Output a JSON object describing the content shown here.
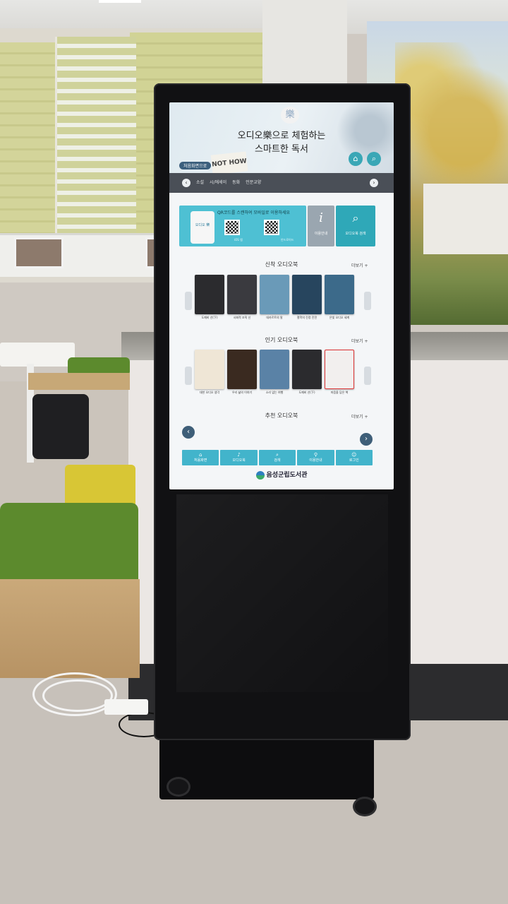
{
  "screen": {
    "hero": {
      "logo_glyph": "樂",
      "title_line1": "오디오樂으로 체험하는",
      "title_line2": "스마트한 독서",
      "back_pill": "처음화면으로",
      "book_text": "NOT HOW"
    },
    "nav": {
      "items": [
        "소설",
        "시/에세이",
        "동화",
        "인문교양"
      ],
      "prev_icon": "‹",
      "next_icon": "›"
    },
    "qr": {
      "instruction": "QR코드를 스캔하여 모바일로 이용하세요",
      "phone_label": "오디오 樂",
      "cap_a": "iOS 앱",
      "cap_b": "안드로이드"
    },
    "info_button": {
      "icon": "i",
      "label": "이용안내"
    },
    "search_button": {
      "icon": "⌕",
      "label": "오디오북 검색"
    },
    "sections": {
      "new": {
        "title": "신착 오디오북",
        "more": "더보기 +"
      },
      "popular": {
        "title": "인기 오디오북",
        "more": "더보기 +"
      },
      "recommended": {
        "title": "추천 오디오북",
        "more": "더보기 +"
      }
    },
    "new_books": [
      {
        "title": "도깨비 선(下)",
        "color": "#2b2b2e"
      },
      {
        "title": "사회적 조직 신",
        "color": "#3a3a3f"
      },
      {
        "title": "데카르트의 말",
        "color": "#6a9ab8"
      },
      {
        "title": "철학의 진정 진전",
        "color": "#27455e"
      },
      {
        "title": "은빛 오디오 세계",
        "color": "#3c6a8a"
      }
    ],
    "popular_books": [
      {
        "title": "대한 오디오 생각",
        "color": "#efe6d6"
      },
      {
        "title": "우리 삶의 이야기",
        "color": "#3a2a20"
      },
      {
        "title": "소리 없는 여행",
        "color": "#5a82a6"
      },
      {
        "title": "도깨비 선(下)",
        "color": "#2b2b2e"
      },
      {
        "title": "마음을 담은 책",
        "color": "#f2efee"
      }
    ],
    "footer": [
      {
        "icon": "⌂",
        "label": "처음화면"
      },
      {
        "icon": "♪",
        "label": "오디오북"
      },
      {
        "icon": "⌕",
        "label": "검색"
      },
      {
        "icon": "⚲",
        "label": "이용안내"
      },
      {
        "icon": "☺",
        "label": "로그인"
      }
    ],
    "brand": "음성군립도서관"
  },
  "colors": {
    "accent": "#42b4cb",
    "nav_bar": "#4a4f57",
    "kiosk_frame": "#111113"
  }
}
